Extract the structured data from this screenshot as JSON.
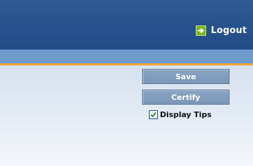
{
  "header": {
    "logout_label": "Logout",
    "logout_icon": "exit-arrow-icon"
  },
  "actions": {
    "save_label": "Save",
    "certify_label": "Certify"
  },
  "tips": {
    "label": "Display Tips",
    "checked": true
  },
  "colors": {
    "header_bg": "#26518c",
    "subbar_bg": "#6f9bcc",
    "accent_line": "#f0a43a",
    "button_bg": "#7b97b8",
    "icon_green": "#7ab51d"
  }
}
